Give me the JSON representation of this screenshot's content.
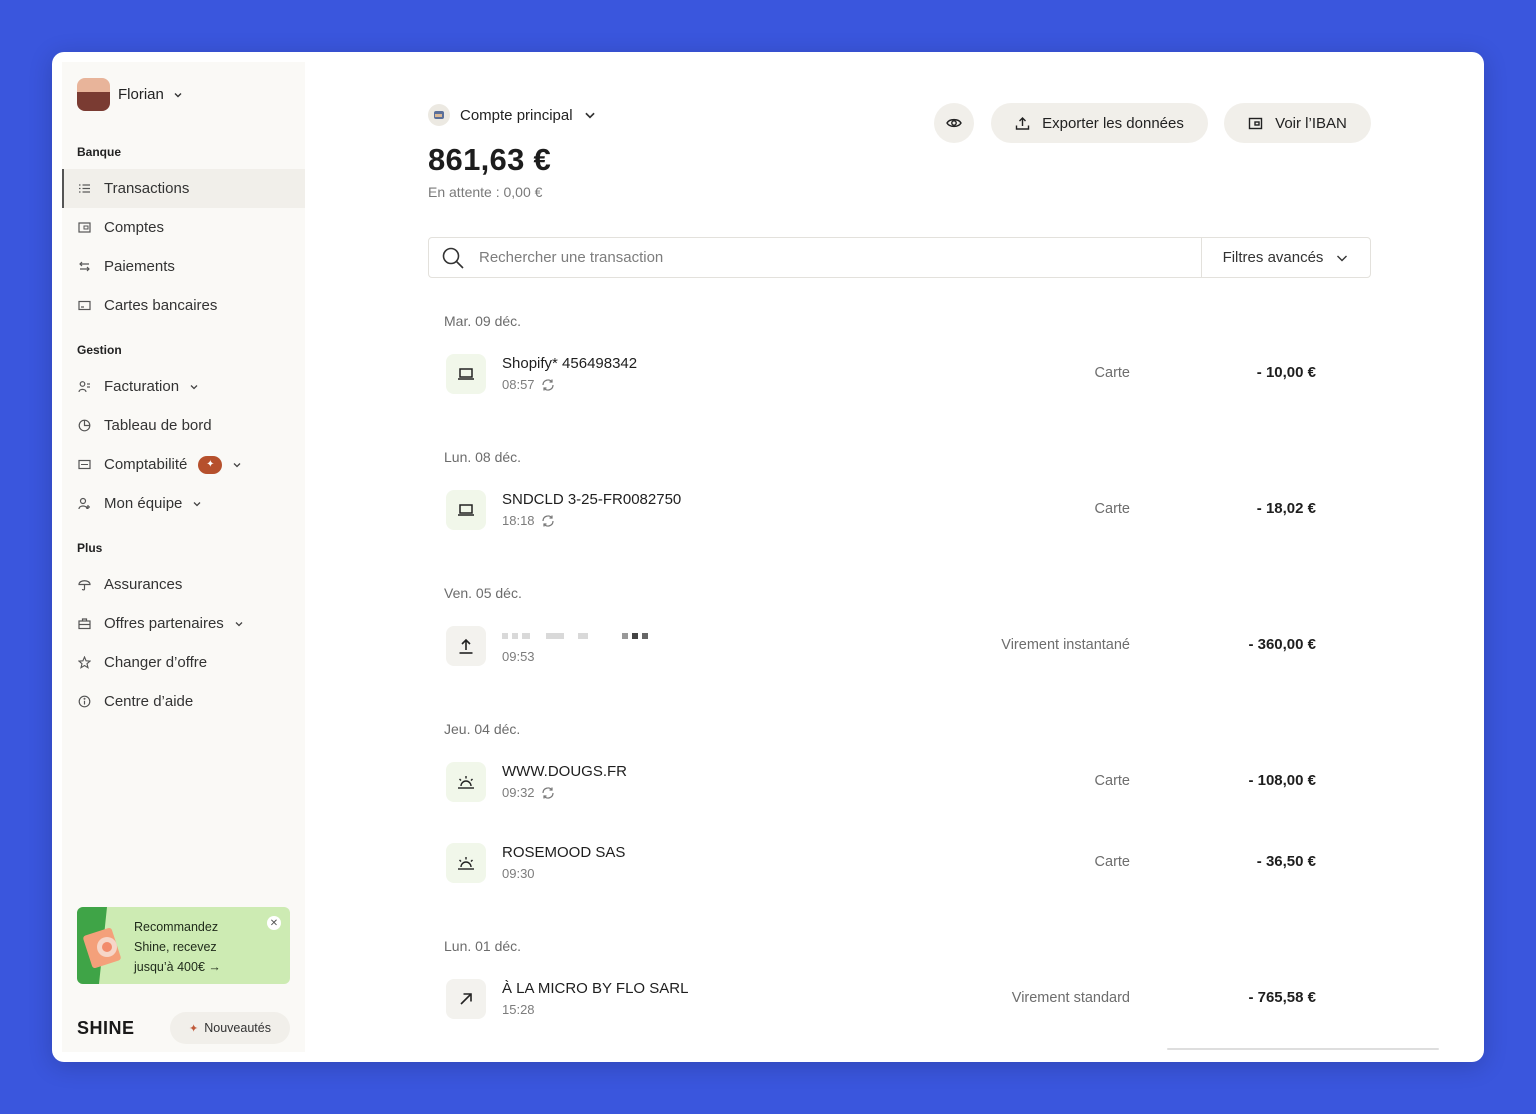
{
  "sidebar": {
    "user_name": "Florian",
    "sections": {
      "banque": "Banque",
      "gestion": "Gestion",
      "plus": "Plus"
    },
    "items": [
      {
        "label": "Transactions",
        "icon": "list-icon"
      },
      {
        "label": "Comptes",
        "icon": "wallet-icon"
      },
      {
        "label": "Paiements",
        "icon": "swap-arrows-icon"
      },
      {
        "label": "Cartes bancaires",
        "icon": "card-icon"
      },
      {
        "label": "Facturation",
        "icon": "invoice-user-icon"
      },
      {
        "label": "Tableau de bord",
        "icon": "pie-chart-icon"
      },
      {
        "label": "Comptabilité",
        "icon": "ledger-icon"
      },
      {
        "label": "Mon équipe",
        "icon": "team-icon"
      },
      {
        "label": "Assurances",
        "icon": "umbrella-icon"
      },
      {
        "label": "Offres partenaires",
        "icon": "briefcase-icon"
      },
      {
        "label": "Changer d’offre",
        "icon": "star-icon"
      },
      {
        "label": "Centre d’aide",
        "icon": "info-icon"
      }
    ],
    "promo": {
      "line1": "Recommandez",
      "line2": "Shine, recevez",
      "line3": "jusqu’à 400€ →"
    },
    "brand": "SHINE",
    "news_label": "Nouveautés"
  },
  "header": {
    "account_name": "Compte principal",
    "balance": "861,63 €",
    "pending": "En attente : 0,00 €",
    "export_label": "Exporter les données",
    "iban_label": "Voir l’IBAN"
  },
  "search": {
    "placeholder": "Rechercher une transaction",
    "filters_label": "Filtres avancés"
  },
  "groups": [
    {
      "date": "Mar. 09 déc."
    },
    {
      "date": "Lun. 08 déc."
    },
    {
      "date": "Ven. 05 déc."
    },
    {
      "date": "Jeu. 04 déc."
    },
    {
      "date": "Lun. 01 déc."
    }
  ],
  "transactions": [
    {
      "title": "Shopify* 456498342",
      "time": "08:57",
      "type": "Carte",
      "amount": "- 10,00 €",
      "icon": "laptop-icon",
      "recurring": true
    },
    {
      "title": "SNDCLD 3-25-FR0082750",
      "time": "18:18",
      "type": "Carte",
      "amount": "- 18,02 €",
      "icon": "laptop-icon",
      "recurring": true
    },
    {
      "title": "",
      "time": "09:53",
      "type": "Virement instantané",
      "amount": "- 360,00 €",
      "icon": "upload-icon",
      "recurring": false
    },
    {
      "title": "WWW.DOUGS.FR",
      "time": "09:32",
      "type": "Carte",
      "amount": "- 108,00 €",
      "icon": "sunrise-icon",
      "recurring": true
    },
    {
      "title": "ROSEMOOD SAS",
      "time": "09:30",
      "type": "Carte",
      "amount": "- 36,50 €",
      "icon": "sunrise-icon",
      "recurring": false
    },
    {
      "title": "À LA MICRO BY FLO SARL",
      "time": "15:28",
      "type": "Virement standard",
      "amount": "- 765,58 €",
      "icon": "arrow-up-right-icon",
      "recurring": false
    }
  ],
  "colors": {
    "background": "#3a56dd",
    "sidebar": "#faf9f6",
    "badge": "#b6502c",
    "promo": "#cdebb3",
    "icon_tile": "#f1f7ea"
  }
}
